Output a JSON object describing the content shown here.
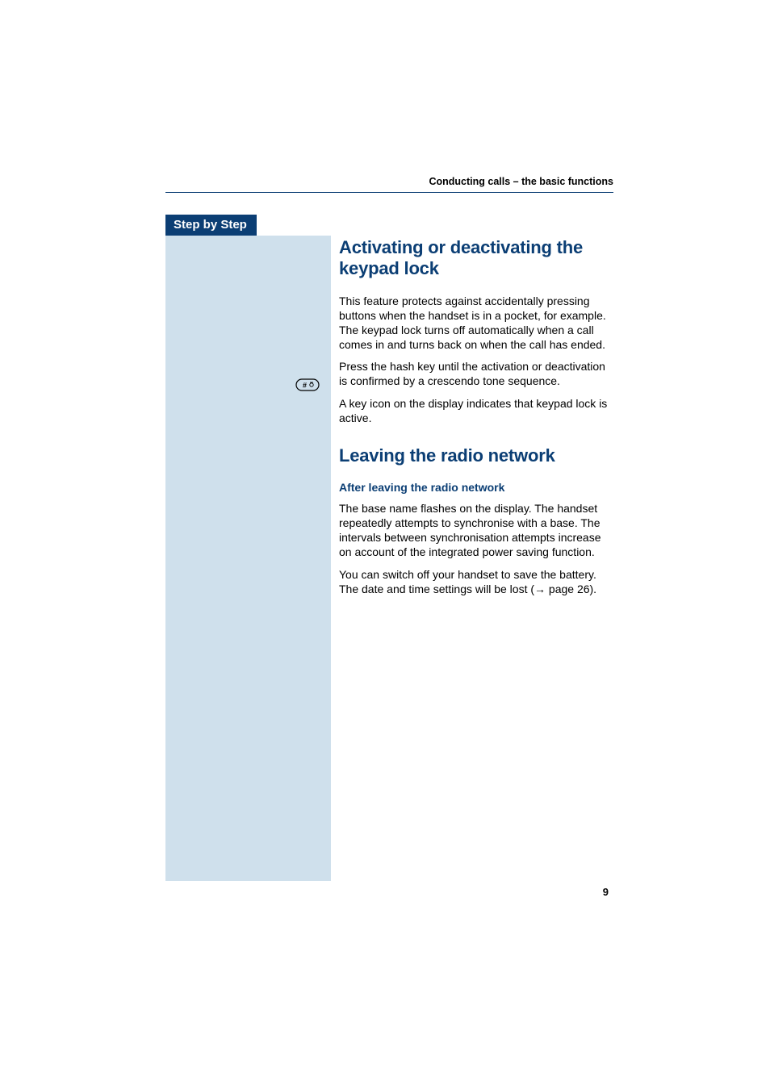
{
  "header": {
    "running_head": "Conducting calls – the basic functions"
  },
  "sidebar": {
    "tab_label": "Step by Step",
    "hash_key_icon": "hash-key-icon"
  },
  "sections": {
    "keypad_lock": {
      "title": "Activating or deactivating the keypad lock",
      "p1": "This feature protects against accidentally pressing buttons when the handset is in a pocket, for example. The keypad lock turns off automatically when a call comes in and turns back on when the call has ended.",
      "p2": "Press the hash key until the activation or deactivation is confirmed by a crescendo tone sequence.",
      "p3": "A key icon on the display indicates that keypad lock is active."
    },
    "leaving_network": {
      "title": "Leaving the radio network",
      "sub": "After leaving the radio network",
      "p1": "The base name flashes on the display. The handset repeatedly attempts to synchronise with a base. The intervals between synchronisation attempts increase on account of the integrated power saving function.",
      "p2_a": "You can switch off your handset to save the battery. The date and time settings will be lost (",
      "p2_arrow": "→",
      "p2_b": " page 26)."
    }
  },
  "page_number": "9"
}
